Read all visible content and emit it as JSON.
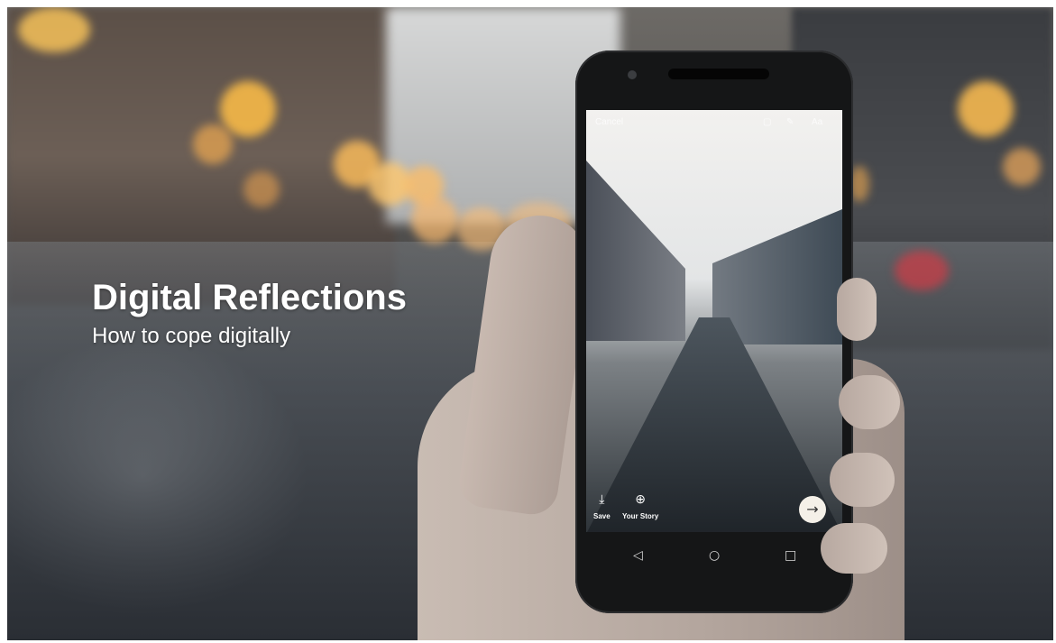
{
  "hero": {
    "title": "Digital Reflections",
    "subtitle": "How to cope digitally"
  },
  "phone": {
    "screen": {
      "top_left": "Cancel",
      "top_icons": [
        "sticker-icon",
        "pencil-icon",
        "text-icon"
      ],
      "actions": [
        {
          "icon": "download-icon",
          "glyph": "⤓",
          "label": "Save"
        },
        {
          "icon": "add-story-icon",
          "glyph": "⊕",
          "label": "Your Story"
        }
      ],
      "send_icon": "→"
    },
    "nav": {
      "back": "◁",
      "home": "○",
      "recents": "□"
    }
  },
  "colors": {
    "title_text": "#ffffff",
    "phone_body": "#151617"
  }
}
